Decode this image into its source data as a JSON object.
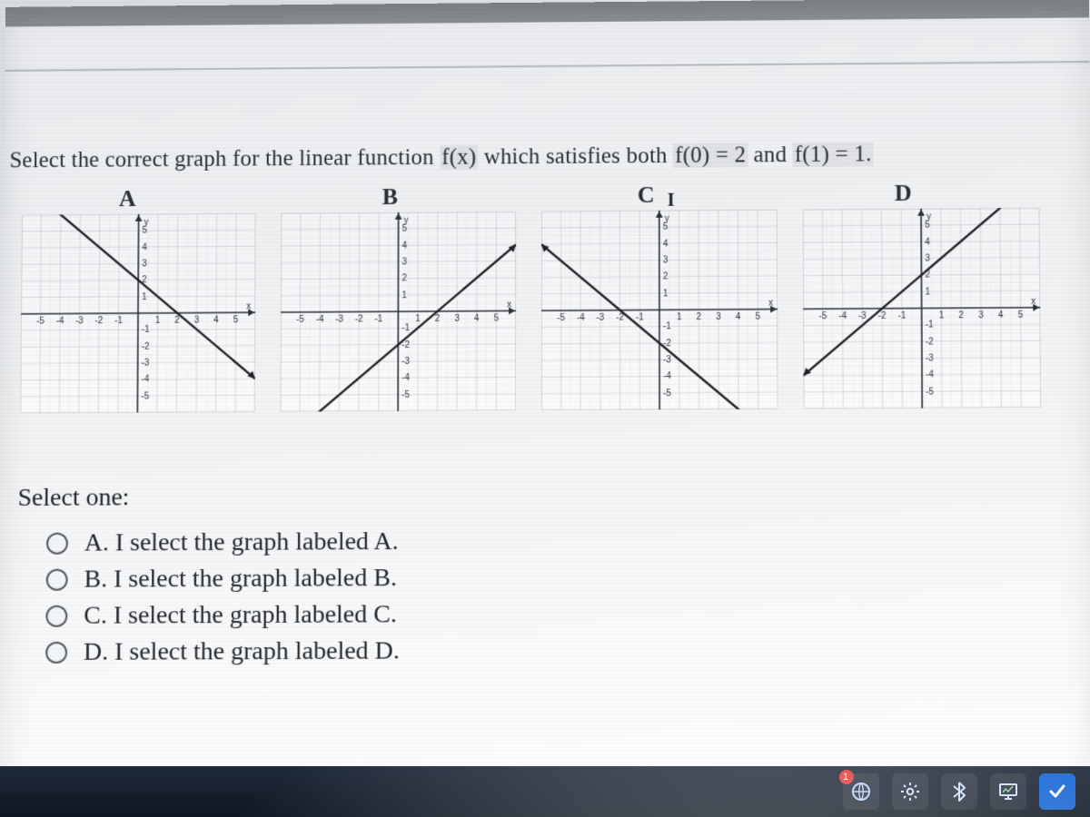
{
  "question_html_parts": {
    "pre": "Select the correct graph for the linear function ",
    "fx": "f(x)",
    "mid": " which satisfies both ",
    "c1": "f(0) = 2",
    "and": " and ",
    "c2": "f(1) = 1."
  },
  "columns": {
    "A": "A",
    "B": "B",
    "C": "C",
    "D": "D"
  },
  "select_one": "Select one:",
  "options": {
    "A": "A. I select the graph labeled A.",
    "B": "B. I select the graph labeled B.",
    "C": "C. I select the graph labeled C.",
    "D": "D. I select the graph labeled D."
  },
  "axis_label_y": "y",
  "axis_label_x": "x",
  "taskbar_badge": "1",
  "chart_data": [
    {
      "type": "line",
      "label": "A",
      "title": "y",
      "xlabel": "x",
      "ylabel": "y",
      "xlim": [
        -5,
        5
      ],
      "ylim": [
        -5,
        5
      ],
      "xticks": [
        -5,
        -4,
        -3,
        -2,
        -1,
        1,
        2,
        3,
        4,
        5
      ],
      "yticks": [
        -5,
        -4,
        -3,
        -2,
        -1,
        1,
        2,
        3,
        4,
        5
      ],
      "series": [
        {
          "name": "f(x) = -x + 2",
          "x": [
            -5,
            5
          ],
          "y": [
            7,
            -3
          ],
          "intercept_y": 2,
          "slope": -1,
          "satisfies_f0_eq_2": true,
          "satisfies_f1_eq_1": true
        }
      ]
    },
    {
      "type": "line",
      "label": "B",
      "title": "y",
      "xlabel": "x",
      "ylabel": "y",
      "xlim": [
        -5,
        5
      ],
      "ylim": [
        -5,
        5
      ],
      "xticks": [
        -5,
        -4,
        -3,
        -2,
        -1,
        1,
        2,
        3,
        4,
        5
      ],
      "yticks": [
        -5,
        -4,
        -3,
        -2,
        -1,
        1,
        2,
        3,
        4,
        5
      ],
      "series": [
        {
          "name": "f(x) = x - 2",
          "x": [
            -5,
            5
          ],
          "y": [
            -7,
            3
          ],
          "intercept_y": -2,
          "slope": 1,
          "satisfies_f0_eq_2": false,
          "satisfies_f1_eq_1": false
        }
      ]
    },
    {
      "type": "line",
      "label": "C",
      "title": "y",
      "xlabel": "x",
      "ylabel": "y",
      "xlim": [
        -5,
        5
      ],
      "ylim": [
        -5,
        5
      ],
      "xticks": [
        -5,
        -4,
        -3,
        -2,
        -1,
        1,
        2,
        3,
        4,
        5
      ],
      "yticks": [
        -5,
        -4,
        -3,
        -2,
        -1,
        1,
        2,
        3,
        4,
        5
      ],
      "series": [
        {
          "name": "f(x) = -x - 2",
          "x": [
            -5,
            5
          ],
          "y": [
            3,
            -7
          ],
          "intercept_y": -2,
          "slope": -1,
          "satisfies_f0_eq_2": false,
          "satisfies_f1_eq_1": false
        }
      ]
    },
    {
      "type": "line",
      "label": "D",
      "title": "y",
      "xlabel": "x",
      "ylabel": "y",
      "xlim": [
        -5,
        5
      ],
      "ylim": [
        -5,
        5
      ],
      "xticks": [
        -5,
        -4,
        -3,
        -2,
        -1,
        1,
        2,
        3,
        4,
        5
      ],
      "yticks": [
        -5,
        -4,
        -3,
        -2,
        -1,
        1,
        2,
        3,
        4,
        5
      ],
      "series": [
        {
          "name": "f(x) = x + 2",
          "x": [
            -5,
            5
          ],
          "y": [
            -3,
            7
          ],
          "intercept_y": 2,
          "slope": 1,
          "satisfies_f0_eq_2": true,
          "satisfies_f1_eq_1": false
        }
      ]
    }
  ]
}
